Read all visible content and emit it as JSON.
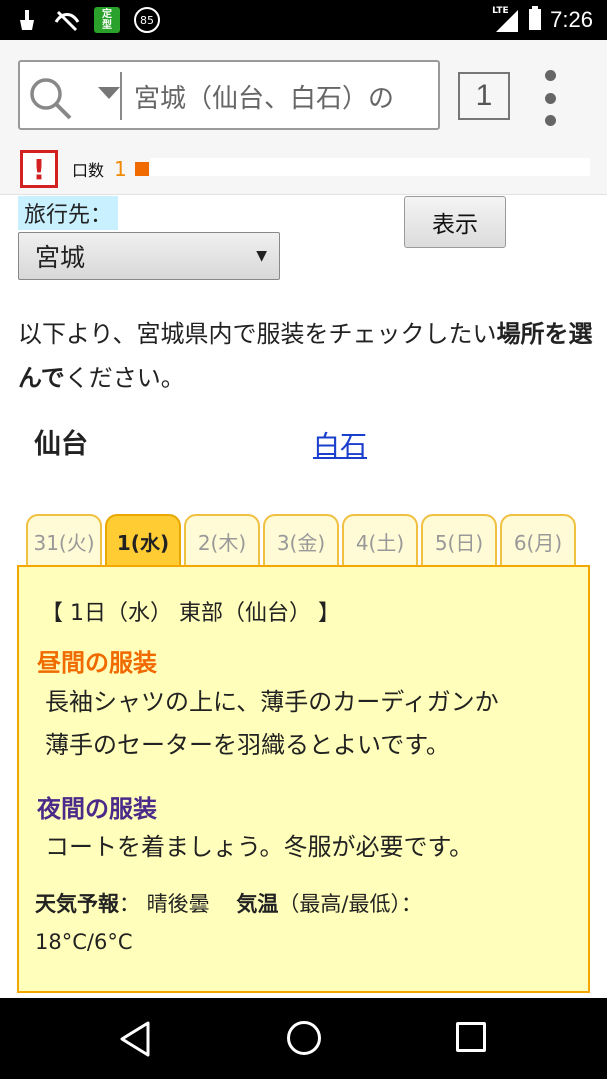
{
  "status_bar": {
    "icons": [
      "broom-icon",
      "no-signal-icon",
      "teiki-icon",
      "battery-85-icon"
    ],
    "teiki_line1": "定",
    "teiki_line2": "型",
    "battery_badge": "85",
    "network": "LTE",
    "time": "7:26"
  },
  "search": {
    "query": "宮城（仙台、白石）の",
    "tab_count": "1"
  },
  "indicator": {
    "label": "口数",
    "value": "1"
  },
  "destination": {
    "label": "旅行先：",
    "selected": "宮城",
    "button_label": "表示"
  },
  "intro": {
    "before": "以下より、宮城県内で服装をチェックしたい",
    "bold": "場所を選んで",
    "after": "ください。"
  },
  "places": {
    "current": "仙台",
    "link": "白石"
  },
  "day_tabs": [
    {
      "label": "31(火)",
      "active": false
    },
    {
      "label": "1(水)",
      "active": true
    },
    {
      "label": "2(木)",
      "active": false
    },
    {
      "label": "3(金)",
      "active": false
    },
    {
      "label": "4(土)",
      "active": false
    },
    {
      "label": "5(日)",
      "active": false
    },
    {
      "label": "6(月)",
      "active": false
    }
  ],
  "forecast": {
    "title": "【 1日（水） 東部（仙台） 】",
    "day_heading": "昼間の服装",
    "day_text_1": "長袖シャツの上に、薄手のカーディガンか",
    "day_text_2": "薄手のセーターを羽織るとよいです。",
    "night_heading": "夜間の服装",
    "night_text": "コートを着ましょう。冬服が必要です。",
    "weather_label": "天気予報",
    "weather_value": "： 晴後曇",
    "temp_label": "気温",
    "temp_suffix": "（最高/最低）：",
    "temp_value": "18°C/6°C"
  },
  "colors": {
    "accent_orange": "#f06a00",
    "night_purple": "#4b2a8a",
    "panel_bg": "#ffffbb",
    "panel_border": "#f4a700",
    "link_blue": "#1a3fcc",
    "alert_red": "#d32020"
  }
}
